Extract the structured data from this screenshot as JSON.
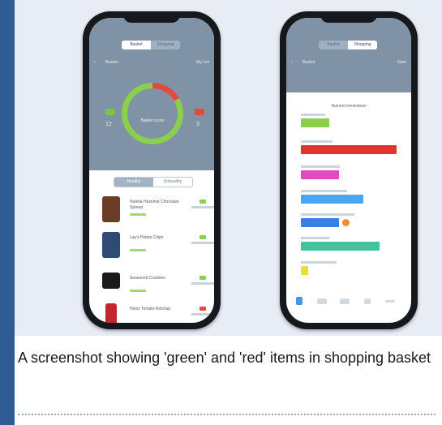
{
  "left_phone": {
    "tabs": [
      "Basket",
      "Shopping"
    ],
    "nav": [
      "‹",
      "Basket",
      "My List"
    ],
    "ring_label": "Basket score",
    "scores": [
      "12",
      "3"
    ],
    "toggle": [
      "Healthy",
      "Unhealthy"
    ],
    "products": [
      {
        "name": "Nutella Hazelnut Chocolate Spread",
        "color": "#6b3d26"
      },
      {
        "name": "Lay's Potato Chips",
        "color": "#2f4a73"
      },
      {
        "name": "Seasoned Crackers",
        "color": "#1a1a1a"
      },
      {
        "name": "Heinz Tomato Ketchup",
        "color": "#c4262e"
      }
    ]
  },
  "right_phone": {
    "tabs": [
      "Basket",
      "Shopping"
    ],
    "nav": [
      "‹",
      "Basket",
      "Stats"
    ],
    "chart_title": "Nutrient breakdown",
    "bars": [
      {
        "color": "#8bcf4e",
        "value": 0.3
      },
      {
        "color": "#e2332f",
        "value": 1.0
      },
      {
        "color": "#e24bbd",
        "value": 0.4
      },
      {
        "color": "#4aa6f0",
        "value": 0.65
      },
      {
        "color": "#3b7ee8",
        "value": 0.4
      },
      {
        "color": "#45c29b",
        "value": 0.82
      },
      {
        "color": "#e8e03a",
        "value": 0.08
      }
    ]
  },
  "caption": "A screenshot showing 'green' and 'red' items in shopping basket"
}
